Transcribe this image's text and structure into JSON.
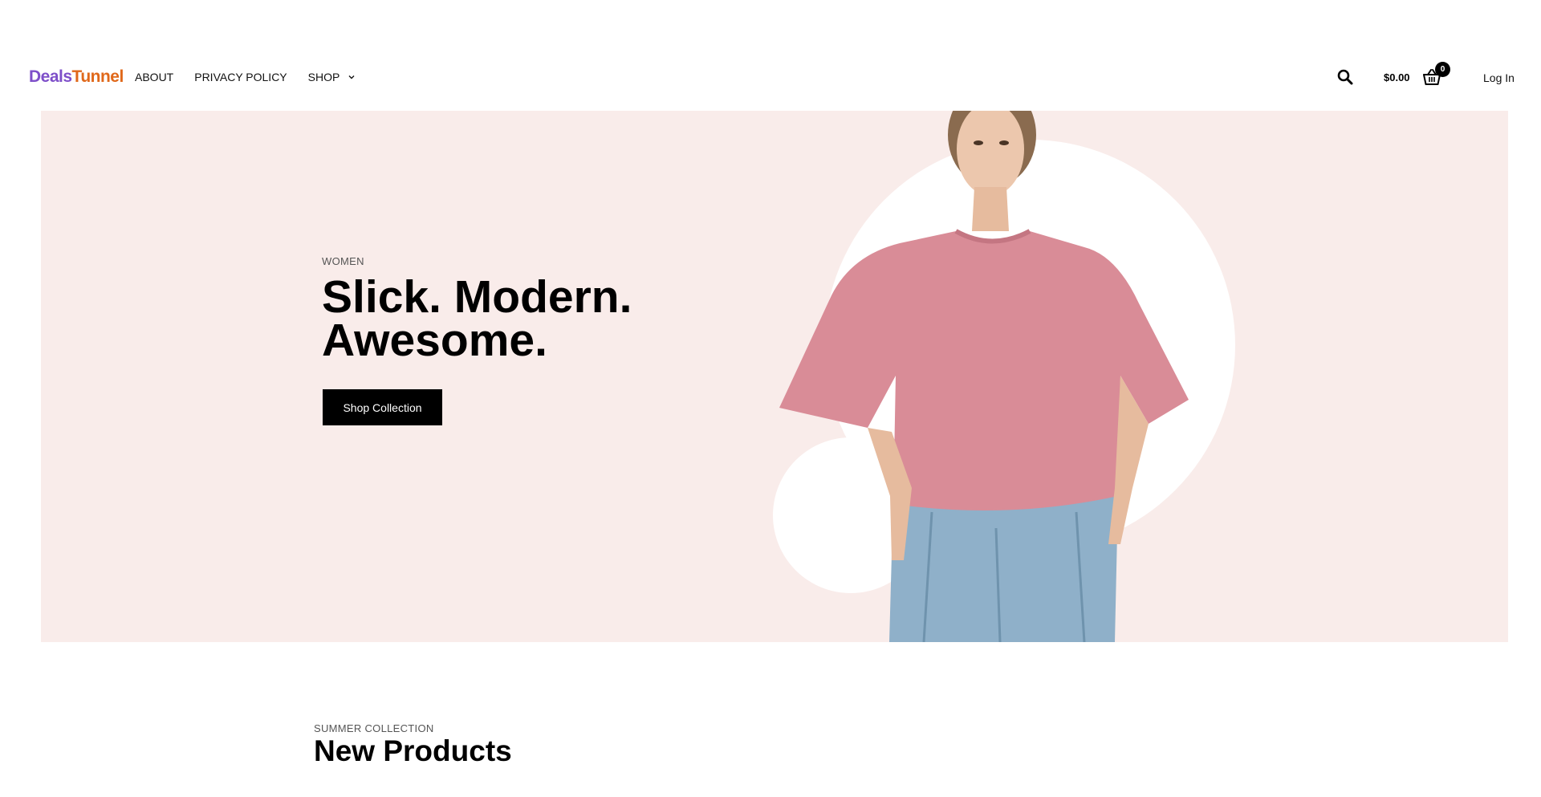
{
  "brand": {
    "logo_part1": "Deals",
    "logo_part2": "Tunnel",
    "color_part1": "#7e4fc9",
    "color_part2": "#e0681a"
  },
  "nav": {
    "items": [
      {
        "label": "ABOUT"
      },
      {
        "label": "PRIVACY POLICY"
      },
      {
        "label": "SHOP",
        "has_dropdown": true
      }
    ]
  },
  "header_actions": {
    "search_icon": "search-icon",
    "cart_total": "$0.00",
    "cart_icon": "basket-icon",
    "cart_count": "0",
    "login_label": "Log In"
  },
  "hero": {
    "tag": "WOMEN",
    "title_line1": "Slick. Modern.",
    "title_line2": "Awesome.",
    "button_label": "Shop Collection",
    "background_color": "#f9ecea",
    "shirt_color": "#d98c97",
    "jeans_color": "#8fb0c9"
  },
  "section": {
    "tag": "SUMMER COLLECTION",
    "title": "New Products"
  }
}
